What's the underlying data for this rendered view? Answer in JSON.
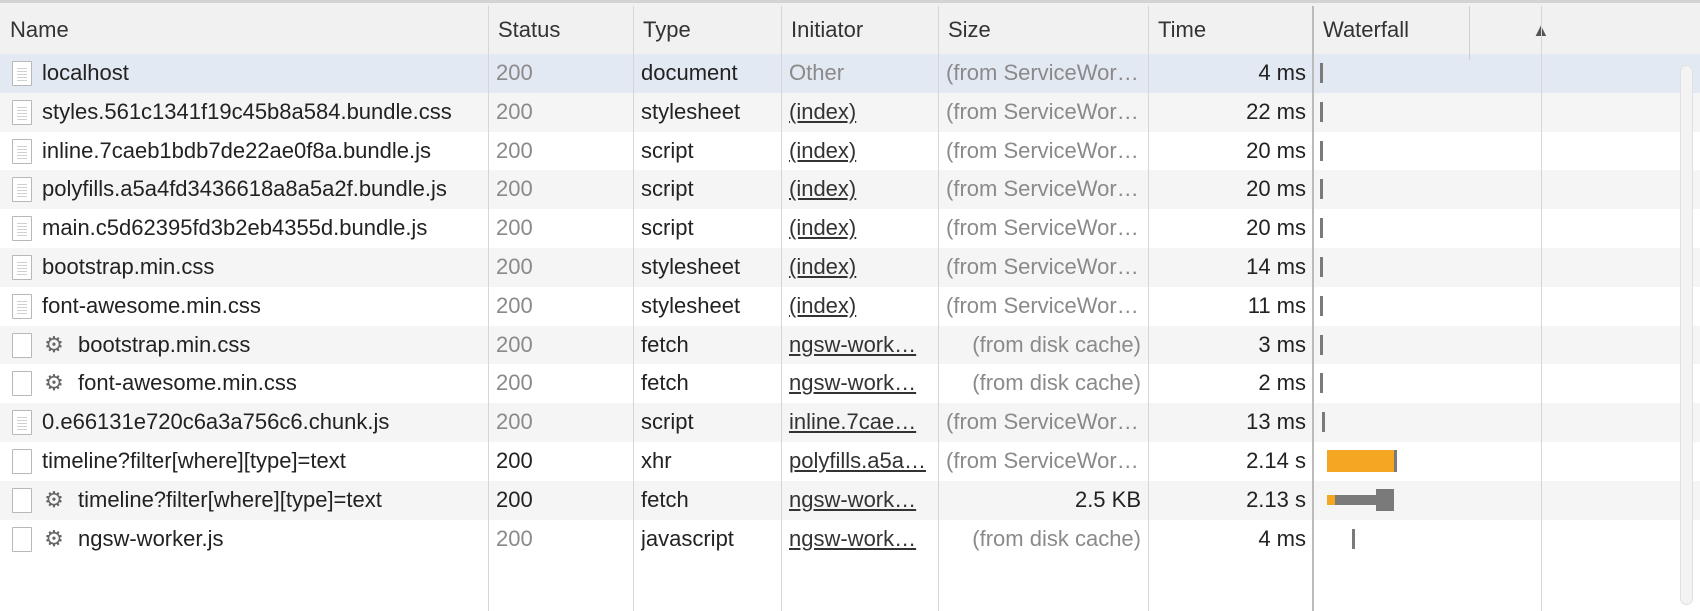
{
  "columns": {
    "name": "Name",
    "status": "Status",
    "type": "Type",
    "initiator": "Initiator",
    "size": "Size",
    "time": "Time",
    "waterfall": "Waterfall"
  },
  "rows": [
    {
      "name": "localhost",
      "status": "200",
      "type": "document",
      "initiator": "Other",
      "initiator_link": false,
      "size": "(from ServiceWor…",
      "time": "4 ms",
      "icon": "document-icon",
      "gear": false,
      "status_gray": true,
      "selected": true
    },
    {
      "name": "styles.561c1341f19c45b8a584.bundle.css",
      "status": "200",
      "type": "stylesheet",
      "initiator": "(index)",
      "initiator_link": true,
      "size": "(from ServiceWor…",
      "time": "22 ms",
      "icon": "document-icon",
      "gear": false,
      "status_gray": true
    },
    {
      "name": "inline.7caeb1bdb7de22ae0f8a.bundle.js",
      "status": "200",
      "type": "script",
      "initiator": "(index)",
      "initiator_link": true,
      "size": "(from ServiceWor…",
      "time": "20 ms",
      "icon": "document-icon",
      "gear": false,
      "status_gray": true
    },
    {
      "name": "polyfills.a5a4fd3436618a8a5a2f.bundle.js",
      "status": "200",
      "type": "script",
      "initiator": "(index)",
      "initiator_link": true,
      "size": "(from ServiceWor…",
      "time": "20 ms",
      "icon": "document-icon",
      "gear": false,
      "status_gray": true
    },
    {
      "name": "main.c5d62395fd3b2eb4355d.bundle.js",
      "status": "200",
      "type": "script",
      "initiator": "(index)",
      "initiator_link": true,
      "size": "(from ServiceWor…",
      "time": "20 ms",
      "icon": "document-icon",
      "gear": false,
      "status_gray": true
    },
    {
      "name": "bootstrap.min.css",
      "status": "200",
      "type": "stylesheet",
      "initiator": "(index)",
      "initiator_link": true,
      "size": "(from ServiceWor…",
      "time": "14 ms",
      "icon": "document-icon",
      "gear": false,
      "status_gray": true
    },
    {
      "name": "font-awesome.min.css",
      "status": "200",
      "type": "stylesheet",
      "initiator": "(index)",
      "initiator_link": true,
      "size": "(from ServiceWor…",
      "time": "11 ms",
      "icon": "document-icon",
      "gear": false,
      "status_gray": true
    },
    {
      "name": "bootstrap.min.css",
      "status": "200",
      "type": "fetch",
      "initiator": "ngsw-work…",
      "initiator_link": true,
      "size": "(from disk cache)",
      "time": "3 ms",
      "icon": "blank-file-icon",
      "gear": true,
      "status_gray": true
    },
    {
      "name": "font-awesome.min.css",
      "status": "200",
      "type": "fetch",
      "initiator": "ngsw-work…",
      "initiator_link": true,
      "size": "(from disk cache)",
      "time": "2 ms",
      "icon": "blank-file-icon",
      "gear": true,
      "status_gray": true
    },
    {
      "name": "0.e66131e720c6a3a756c6.chunk.js",
      "status": "200",
      "type": "script",
      "initiator": "inline.7cae…",
      "initiator_link": true,
      "size": "(from ServiceWor…",
      "time": "13 ms",
      "icon": "document-icon",
      "gear": false,
      "status_gray": true
    },
    {
      "name": "timeline?filter[where][type]=text",
      "status": "200",
      "type": "xhr",
      "initiator": "polyfills.a5a…",
      "initiator_link": true,
      "size": "(from ServiceWor…",
      "time": "2.14 s",
      "icon": "blank-file-icon",
      "gear": false,
      "status_gray": false
    },
    {
      "name": "timeline?filter[where][type]=text",
      "status": "200",
      "type": "fetch",
      "initiator": "ngsw-work…",
      "initiator_link": true,
      "size": "2.5 KB",
      "size_dark": true,
      "time": "2.13 s",
      "icon": "blank-file-icon",
      "gear": true,
      "status_gray": false
    },
    {
      "name": "ngsw-worker.js",
      "status": "200",
      "type": "javascript",
      "initiator": "ngsw-work…",
      "initiator_link": true,
      "size": "(from disk cache)",
      "time": "4 ms",
      "icon": "blank-file-icon",
      "gear": true,
      "status_gray": true
    }
  ],
  "waterfall_bars": [
    {
      "row": 0,
      "kind": "tick",
      "start": 0.0,
      "end": 0.003
    },
    {
      "row": 1,
      "kind": "tick",
      "start": 0.0,
      "end": 0.003
    },
    {
      "row": 2,
      "kind": "tick",
      "start": 0.0,
      "end": 0.003
    },
    {
      "row": 3,
      "kind": "tick",
      "start": 0.0,
      "end": 0.003
    },
    {
      "row": 4,
      "kind": "tick",
      "start": 0.0,
      "end": 0.003
    },
    {
      "row": 5,
      "kind": "tick",
      "start": 0.0,
      "end": 0.003
    },
    {
      "row": 6,
      "kind": "tick",
      "start": 0.0,
      "end": 0.003
    },
    {
      "row": 7,
      "kind": "tick",
      "start": 0.0,
      "end": 0.003
    },
    {
      "row": 8,
      "kind": "tick",
      "start": 0.0,
      "end": 0.003
    },
    {
      "row": 9,
      "kind": "tick",
      "start": 0.01,
      "end": 0.012
    },
    {
      "row": 10,
      "kind": "orange",
      "start": 0.03,
      "end": 0.32
    },
    {
      "row": 11,
      "kind": "mixed",
      "start": 0.03,
      "end": 0.32
    },
    {
      "row": 12,
      "kind": "tick",
      "start": 0.14,
      "end": 0.145
    }
  ],
  "colors": {
    "selected_row": "#e3e9f3",
    "alt_row": "#f5f5f5",
    "waterfall_orange": "#f5a623",
    "waterfall_gray": "#7a7a7a"
  }
}
